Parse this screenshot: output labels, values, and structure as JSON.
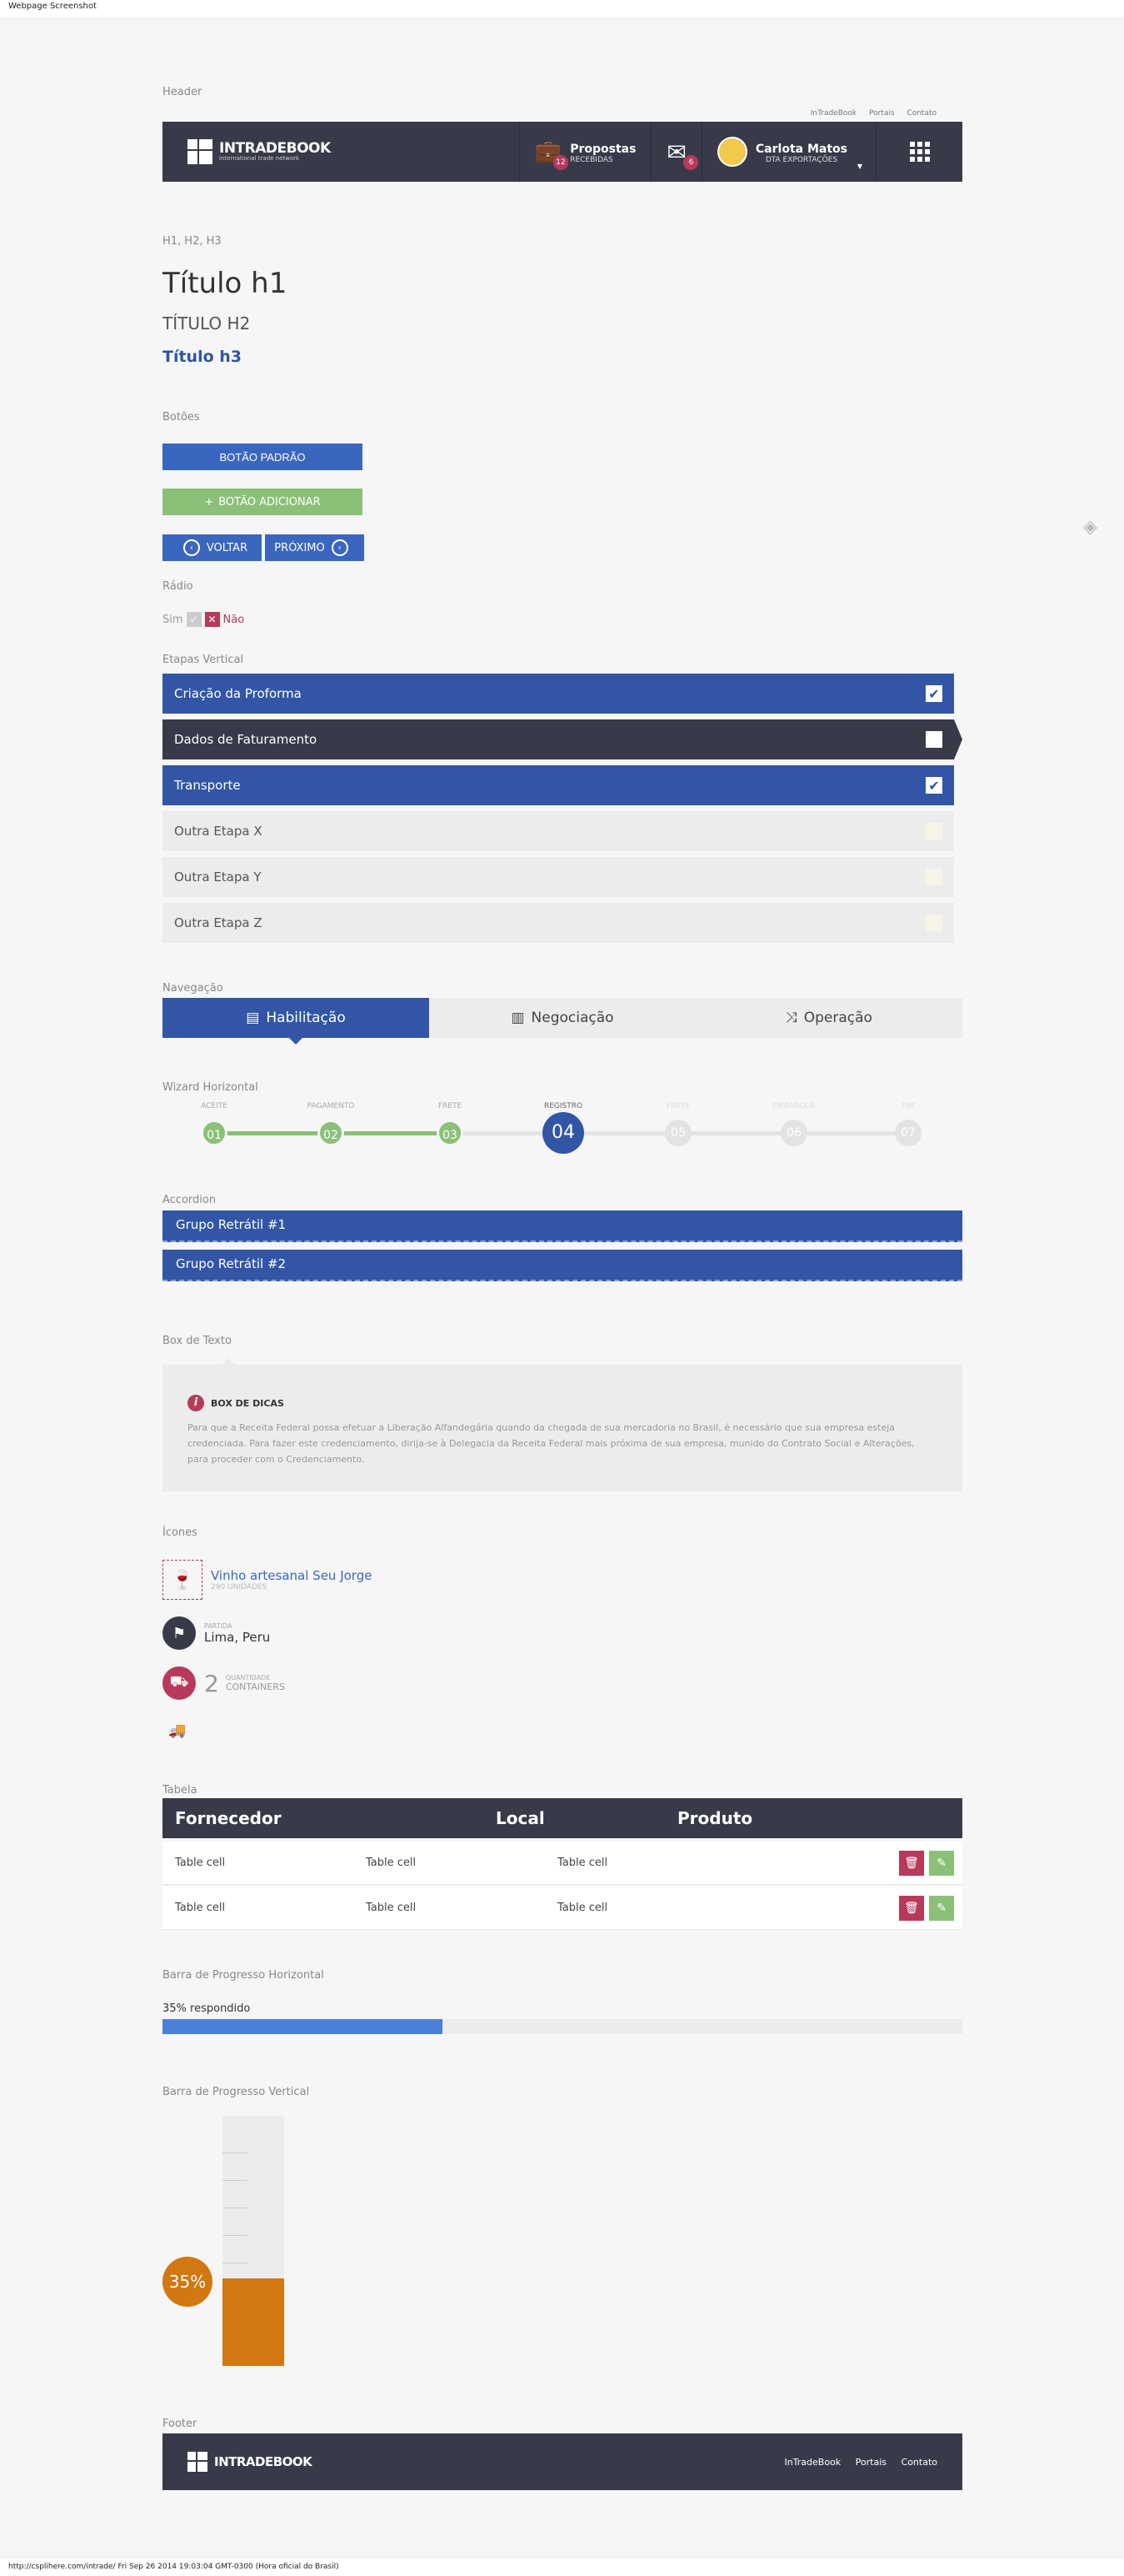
{
  "capture": {
    "title": "Webpage Screenshot",
    "footer": "http://csplihere.com/intrade/ Fri Sep 26 2014 19:03:04 GMT-0300 (Hora oficial do Brasil)"
  },
  "sections": {
    "header": "Header",
    "headings": "H1, H2, H3",
    "buttons": "Botões",
    "radio": "Rádio",
    "steps": "Etapas Vertical",
    "nav": "Navegação",
    "wizard": "Wizard Horizontal",
    "accordion": "Accordion",
    "textbox": "Box de Texto",
    "icons": "Ícones",
    "table": "Tabela",
    "hprogress": "Barra de Progresso Horizontal",
    "vprogress": "Barra de Progresso Vertical",
    "footer": "Footer"
  },
  "toplinks": [
    "InTradeBook",
    "Portais",
    "Contato"
  ],
  "header": {
    "logo_name": "INTRADEBOOK",
    "logo_sub": "international trade network",
    "proposals_label": "Propostas",
    "proposals_sub": "RECEBIDAS",
    "proposals_count": "12",
    "messages_count": "6",
    "user_name": "Carlota Matos",
    "user_company": "DTA EXPORTAÇÕES"
  },
  "headings": {
    "h1": "Título h1",
    "h2": "TÍTULO H2",
    "h3": "Título h3"
  },
  "buttons": {
    "default": "BOTÃO PADRÃO",
    "add": "BOTÃO ADICIONAR",
    "back": "VOLTAR",
    "next": "PRÓXIMO"
  },
  "radio": {
    "yes": "Sim",
    "no": "Não"
  },
  "steps": [
    {
      "label": "Criação da Proforma",
      "state": "done"
    },
    {
      "label": "Dados de Faturamento",
      "state": "current"
    },
    {
      "label": "Transporte",
      "state": "done"
    },
    {
      "label": "Outra Etapa X",
      "state": "todo"
    },
    {
      "label": "Outra Etapa Y",
      "state": "todo"
    },
    {
      "label": "Outra Etapa Z",
      "state": "todo"
    }
  ],
  "nav": {
    "tab1": "Habilitação",
    "tab2": "Negociação",
    "tab3": "Operação"
  },
  "wizard": [
    {
      "label": "ACEITE",
      "num": "01"
    },
    {
      "label": "PAGAMENTO",
      "num": "02"
    },
    {
      "label": "FRETE",
      "num": "03"
    },
    {
      "label": "REGISTRO",
      "num": "04"
    },
    {
      "label": "FRETE",
      "num": "05"
    },
    {
      "label": "EMBARQUE",
      "num": "06"
    },
    {
      "label": "FIM",
      "num": "07"
    }
  ],
  "accordion": {
    "g1": "Grupo Retrátil #1",
    "g2": "Grupo Retrátil #2"
  },
  "textbox": {
    "title": "BOX DE DICAS",
    "body": "Para que a Receita Federal possa efetuar a Liberação Alfandegária quando da chegada de sua mercadoria no Brasil, é necessário que sua empresa esteja credenciada. Para fazer este credenciamento, dirija-se à Delegacia da Receita Federal mais próxima de sua empresa, munido do Contrato Social e Alterações, para proceder com o Credenciamento."
  },
  "icons": {
    "product_name": "Vinho artesanal Seu Jorge",
    "product_units": "290 UNIDADES",
    "departure_label": "PARTIDA",
    "departure_value": "Lima, Peru",
    "qty_number": "2",
    "qty_label": "QUANTIDADE",
    "qty_unit": "CONTAINERS"
  },
  "table": {
    "headers": [
      "Fornecedor",
      "Local",
      "Produto"
    ],
    "rows": [
      [
        "Table cell",
        "Table cell",
        "Table cell"
      ],
      [
        "Table cell",
        "Table cell",
        "Table cell"
      ]
    ]
  },
  "hprogress": {
    "label": "35% respondido",
    "value": 0.35
  },
  "vprogress": {
    "label": "35%",
    "value": 0.35
  },
  "footer": {
    "logo_name": "INTRADEBOOK",
    "links": [
      "InTradeBook",
      "Portais",
      "Contato"
    ]
  },
  "colors": {
    "primary": "#3256a5",
    "dark": "#383a4a",
    "green": "#8bc078",
    "accent": "#b73a5a",
    "orange": "#d27711"
  }
}
